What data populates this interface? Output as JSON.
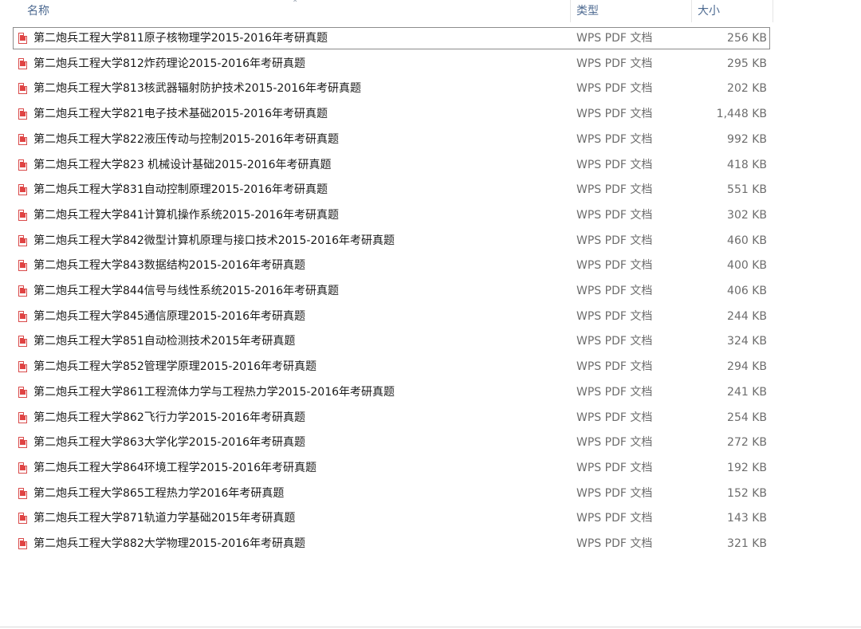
{
  "columns": {
    "name": "名称",
    "type": "类型",
    "size": "大小"
  },
  "files": [
    {
      "name": "第二炮兵工程大学811原子核物理学2015-2016年考研真题",
      "type": "WPS PDF 文档",
      "size": "256 KB"
    },
    {
      "name": "第二炮兵工程大学812炸药理论2015-2016年考研真题",
      "type": "WPS PDF 文档",
      "size": "295 KB"
    },
    {
      "name": "第二炮兵工程大学813核武器辐射防护技术2015-2016年考研真题",
      "type": "WPS PDF 文档",
      "size": "202 KB"
    },
    {
      "name": "第二炮兵工程大学821电子技术基础2015-2016年考研真题",
      "type": "WPS PDF 文档",
      "size": "1,448 KB"
    },
    {
      "name": "第二炮兵工程大学822液压传动与控制2015-2016年考研真题",
      "type": "WPS PDF 文档",
      "size": "992 KB"
    },
    {
      "name": "第二炮兵工程大学823 机械设计基础2015-2016年考研真题",
      "type": "WPS PDF 文档",
      "size": "418 KB"
    },
    {
      "name": "第二炮兵工程大学831自动控制原理2015-2016年考研真题",
      "type": "WPS PDF 文档",
      "size": "551 KB"
    },
    {
      "name": "第二炮兵工程大学841计算机操作系统2015-2016年考研真题",
      "type": "WPS PDF 文档",
      "size": "302 KB"
    },
    {
      "name": "第二炮兵工程大学842微型计算机原理与接口技术2015-2016年考研真题",
      "type": "WPS PDF 文档",
      "size": "460 KB"
    },
    {
      "name": "第二炮兵工程大学843数据结构2015-2016年考研真题",
      "type": "WPS PDF 文档",
      "size": "400 KB"
    },
    {
      "name": "第二炮兵工程大学844信号与线性系统2015-2016年考研真题",
      "type": "WPS PDF 文档",
      "size": "406 KB"
    },
    {
      "name": "第二炮兵工程大学845通信原理2015-2016年考研真题",
      "type": "WPS PDF 文档",
      "size": "244 KB"
    },
    {
      "name": "第二炮兵工程大学851自动检测技术2015年考研真题",
      "type": "WPS PDF 文档",
      "size": "324 KB"
    },
    {
      "name": "第二炮兵工程大学852管理学原理2015-2016年考研真题",
      "type": "WPS PDF 文档",
      "size": "294 KB"
    },
    {
      "name": "第二炮兵工程大学861工程流体力学与工程热力学2015-2016年考研真题",
      "type": "WPS PDF 文档",
      "size": "241 KB"
    },
    {
      "name": "第二炮兵工程大学862飞行力学2015-2016年考研真题",
      "type": "WPS PDF 文档",
      "size": "254 KB"
    },
    {
      "name": "第二炮兵工程大学863大学化学2015-2016年考研真题",
      "type": "WPS PDF 文档",
      "size": "272 KB"
    },
    {
      "name": "第二炮兵工程大学864环境工程学2015-2016年考研真题",
      "type": "WPS PDF 文档",
      "size": "192 KB"
    },
    {
      "name": "第二炮兵工程大学865工程热力学2016年考研真题",
      "type": "WPS PDF 文档",
      "size": "152 KB"
    },
    {
      "name": "第二炮兵工程大学871轨道力学基础2015年考研真题",
      "type": "WPS PDF 文档",
      "size": "143 KB"
    },
    {
      "name": "第二炮兵工程大学882大学物理2015-2016年考研真题",
      "type": "WPS PDF 文档",
      "size": "321 KB"
    }
  ],
  "icons": {
    "file": "pdf-file-icon",
    "sort": "sort-up-icon"
  },
  "colors": {
    "header_text": "#4d6a91",
    "icon_accent": "#e04343"
  }
}
